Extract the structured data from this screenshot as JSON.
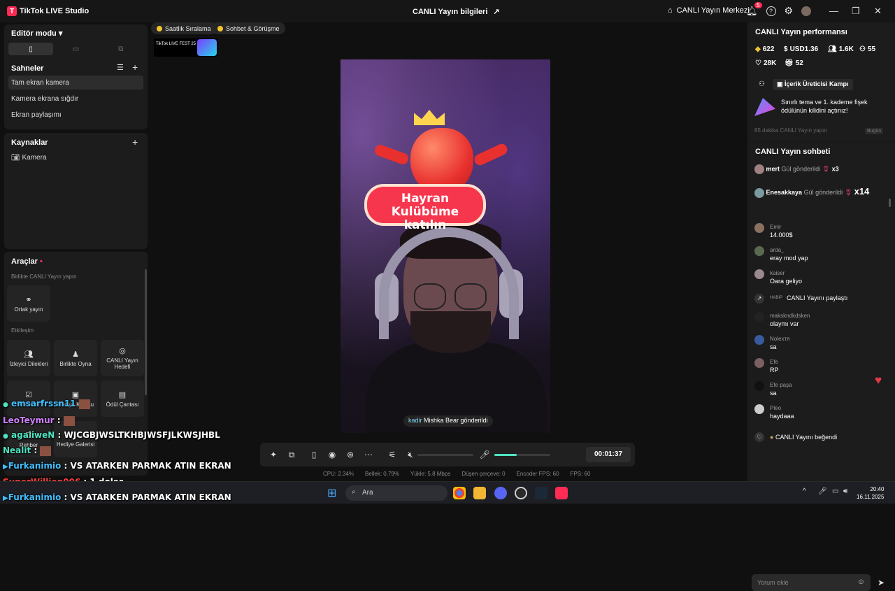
{
  "app": {
    "title": "TikTok LIVE Studio",
    "logo": "T",
    "center_title": "CANLI Yayın bilgileri",
    "center_icon": "share-icon",
    "live_center": "CANLI Yayın Merkezi",
    "notif_count": "5"
  },
  "left": {
    "editor_mode": "Editör modu",
    "scenes_title": "Sahneler",
    "scenes": [
      "Tam ekran kamera",
      "Kamera ekrana sığdır",
      "Ekran paylaşımı"
    ],
    "sources_title": "Kaynaklar",
    "sources": [
      "Kamera"
    ],
    "tools_title": "Araçlar",
    "together_title": "Birlikte CANLI Yayın yapın",
    "cohost": "Ortak yayın",
    "interact_title": "Etkileşim",
    "tools": [
      {
        "label": "İzleyici Dilekleri",
        "icon": "users-icon"
      },
      {
        "label": "Birlikte Oyna",
        "icon": "gamepad-icon"
      },
      {
        "label": "CANLI Yayın Hedefi",
        "icon": "target-icon"
      },
      {
        "label": "Anket ve",
        "icon": "poll-icon"
      },
      {
        "label": "Hediye Kutusu",
        "icon": "gift-box-icon"
      },
      {
        "label": "Ödül Çantası",
        "icon": "bag-icon"
      },
      {
        "label": "Rehber",
        "icon": "guide-icon"
      },
      {
        "label": "Hediye Galerisi",
        "icon": "gallery-icon"
      }
    ]
  },
  "center": {
    "chip1": "Saatlik Sıralama",
    "chip2": "Sohbet & Görüşme",
    "fest": "TikTok LIVE FEST 25",
    "banner_line1": "Hayran Kulübüme",
    "banner_line2": "katılın",
    "toast_name": "kadir",
    "toast_text": "Mishka Bear gönderildi",
    "timer": "00:01:37",
    "volume_level": 0.4,
    "stats": [
      "CPU: 2.34%",
      "Bellek: 0.79%",
      "Yükle: 5.8 Mbps",
      "Düşen çerçeve: 0",
      "Encoder FPS: 60",
      "FPS: 60"
    ]
  },
  "right": {
    "perf_title": "CANLI Yayın performansı",
    "metrics": {
      "diamonds": "622",
      "usd": "USD1.36",
      "viewers": "1.6K",
      "followers": "55",
      "likes": "28K",
      "gifts": "52"
    },
    "campaign": "İçerik Üreticisi Kampı",
    "promo_line1": "Sınırlı tema ve 1. kademe fişek",
    "promo_line2": "ödülünün kilidini açtınız!",
    "promo_footer": "85 dakika CANLI Yayın yapın",
    "promo_badge": "Bugün",
    "chat_title": "CANLI Yayın sohbeti",
    "gifts": [
      {
        "user": "mert",
        "text": "Gül gönderildi",
        "count": "x3"
      },
      {
        "user": "Enesakkaya",
        "text": "Gül gönderildi",
        "count": "x14"
      }
    ],
    "messages": [
      {
        "user": "Emir",
        "text": "14.000$"
      },
      {
        "user": "arda_",
        "text": "eray mod yap"
      },
      {
        "user": "kaiser",
        "text": "Oara geliyo"
      },
      {
        "user": "HABIP",
        "text": "CANLI Yayını paylaştı"
      },
      {
        "user": "makskndkdsken",
        "text": "olaymı var"
      },
      {
        "user": "Nolexтя",
        "text": "sa"
      },
      {
        "user": "Efe",
        "text": "RP"
      },
      {
        "user": "Efe paşa",
        "text": "sa"
      },
      {
        "user": "Pleo",
        "text": "haydaaa"
      }
    ],
    "liked": "CANLI Yayını beğendi",
    "input_placeholder": "Yorum ekle"
  },
  "overlay": [
    {
      "name": "emsarfrssn11",
      "text": ""
    },
    {
      "name": "LeoTeymur",
      "text": ":"
    },
    {
      "name": "agaliweN",
      "text": ": WJCGBJWSLTKHBJWSFJLKWSJHBL"
    },
    {
      "name": "Nealit",
      "text": ":"
    },
    {
      "name": "Furkanimio",
      "text": ": VS ATARKEN PARMAK ATIN EKRAN"
    },
    {
      "name": "SuperWillian006",
      "text": ": 1 dolar"
    },
    {
      "name": "Furkanimio",
      "text": ": VS ATARKEN PARMAK ATIN EKRAN"
    }
  ],
  "taskbar": {
    "search": "Ara",
    "time": "20:40",
    "date": "16.11.2025"
  }
}
